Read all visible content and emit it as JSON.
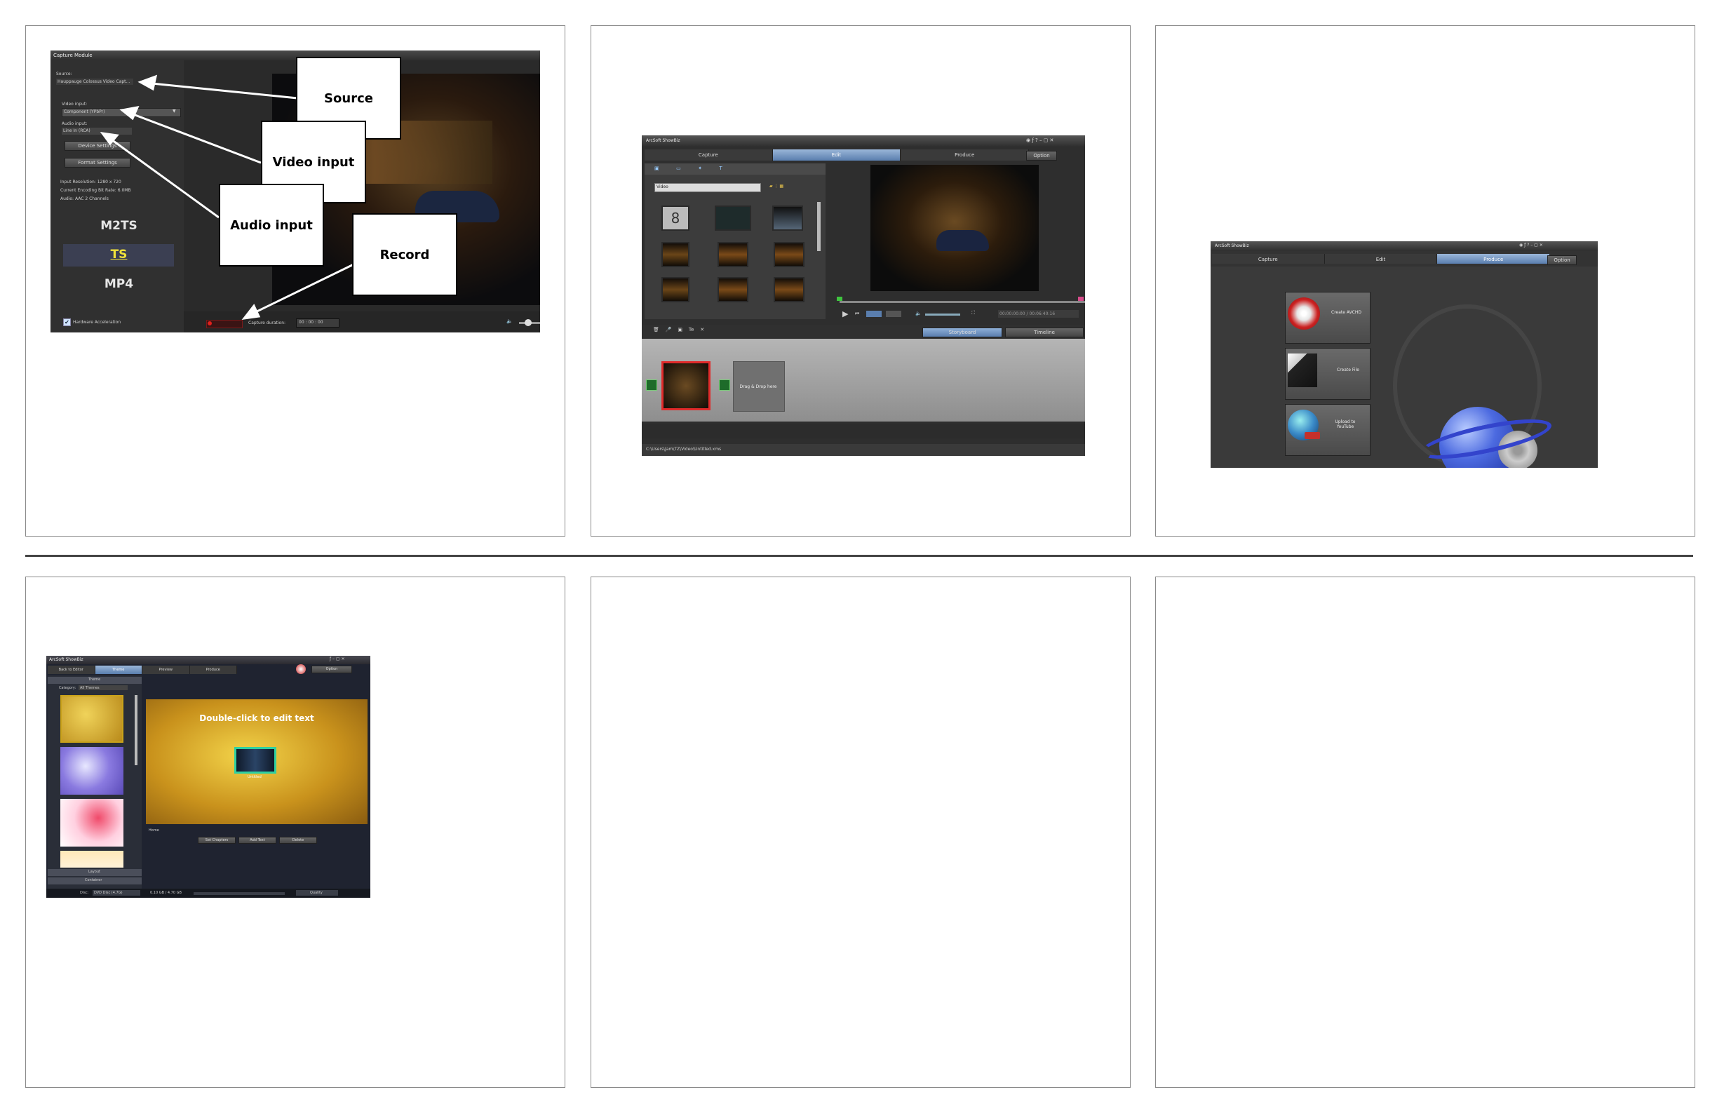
{
  "capture": {
    "title": "Capture Module",
    "source_label": "Source:",
    "source_value": "Hauppauge Colossus Video Capt...",
    "video_input_label": "Video input:",
    "video_input_value": "Component (YPbPr)",
    "audio_input_label": "Audio input:",
    "audio_input_value": "Line In (RCA)",
    "device_settings": "Device Settings",
    "format_settings": "Format Settings",
    "input_resolution": "Input Resolution: 1280 x 720",
    "encoding_bitrate": "Current Encoding Bit Rate: 6.0MB",
    "audio_info": "Audio: AAC 2 Channels",
    "formats": [
      "M2TS",
      "TS",
      "MP4"
    ],
    "hw_accel": "Hardware Acceleration",
    "capture_duration_label": "Capture duration:",
    "capture_duration_value": "00 : 00 : 00",
    "callouts": {
      "source": "Source",
      "video_input": "Video input",
      "audio_input": "Audio input",
      "record": "Record"
    }
  },
  "edit": {
    "app_title": "ArcSoft ShowBiz",
    "tabs": [
      "Capture",
      "Edit",
      "Produce"
    ],
    "option": "Option",
    "media_filter": "Video",
    "storyboard": "Storyboard",
    "timeline": "Timeline",
    "drop_here": "Drag & Drop here",
    "path": "C:\\Users\\Jam\\TZ\\Video\\Untitled.xms",
    "time_readout": "00:00:00:00 / 00:06:40:16"
  },
  "produce": {
    "app_title": "ArcSoft ShowBiz",
    "tabs": [
      "Capture",
      "Edit",
      "Produce"
    ],
    "option": "Option",
    "items": [
      "Create AVCHD",
      "Create File",
      "Upload to YouTube"
    ]
  },
  "disc": {
    "app_title": "ArcSoft ShowBiz",
    "tabs": [
      "Back to Editor",
      "Theme",
      "Preview",
      "Produce"
    ],
    "option": "Option",
    "theme_header": "Theme",
    "category_label": "Category:",
    "category_value": "All Themes",
    "layout": "Layout",
    "container": "Container",
    "edit_text": "Double-click to edit text",
    "untitled": "Untitled",
    "home": "Home",
    "buttons": [
      "Set Chapters",
      "Add Text",
      "Delete"
    ],
    "disc_label": "Disc:",
    "disc_value": "DVD Disc (4.7G)",
    "size": "0.10 GB / 4.70 GB",
    "quality": "Quality"
  },
  "colors": {
    "ui_dark": "#2c2c2c",
    "accent_blue": "#6f93c4",
    "record_red": "#e0201c",
    "ts_yellow": "#f0e23a"
  }
}
